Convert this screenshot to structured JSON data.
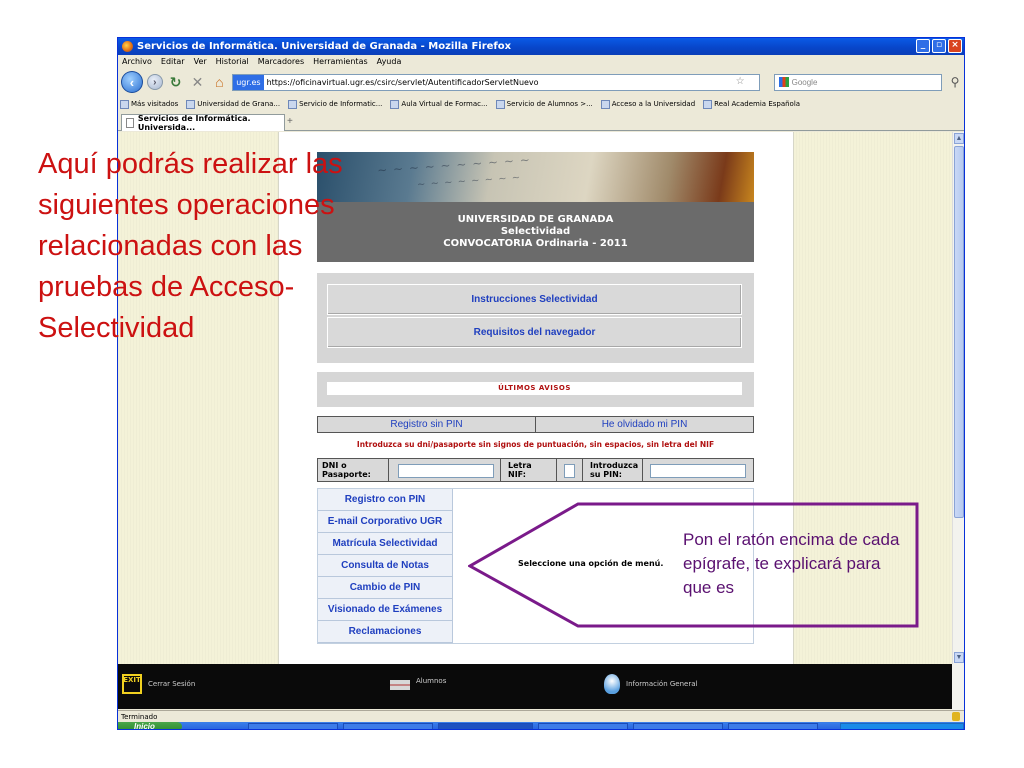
{
  "window": {
    "title": "Servicios de Informática. Universidad de Granada - Mozilla Firefox",
    "menu": [
      "Archivo",
      "Editar",
      "Ver",
      "Historial",
      "Marcadores",
      "Herramientas",
      "Ayuda"
    ],
    "url_site": "ugr.es",
    "url": "https://oficinavirtual.ugr.es/csirc/servlet/AutentificadorServletNuevo",
    "search_placeholder": "Google",
    "bookmarks": [
      "Más visitados",
      "Universidad de Grana...",
      "Servicio de Informatic...",
      "Aula Virtual de Formac...",
      "Servicio de Alumnos >...",
      "Acceso a la Universidad",
      "Real Academia Española"
    ],
    "tab_label": "Servicios de Informática. Universida...",
    "status": "Terminado"
  },
  "page": {
    "header_line1": "UNIVERSIDAD DE GRANADA",
    "header_line2": "Selectividad",
    "header_line3": "CONVOCATORIA Ordinaria - 2011",
    "instr_1": "Instrucciones Selectividad",
    "instr_2": "Requisitos del navegador",
    "avisos": "ÚLTIMOS AVISOS",
    "registro_sin_pin": "Registro sin PIN",
    "olvidado_pin": "He olvidado mi PIN",
    "intro_text": "Introduzca su dni/pasaporte sin signos de puntuación, sin espacios, sin letra del NIF",
    "dni_label_1": "DNI o",
    "dni_label_2": "Pasaporte:",
    "nif_label_1": "Letra",
    "nif_label_2": "NIF:",
    "pin_label_1": "Introduzca",
    "pin_label_2": "su PIN:",
    "menu_items": [
      "Registro con PIN",
      "E-mail Corporativo UGR",
      "Matrícula Selectividad",
      "Consulta de Notas",
      "Cambio de PIN",
      "Visionado de Exámenes",
      "Reclamaciones"
    ],
    "select_msg": "Seleccione una opción de menú."
  },
  "appbar": {
    "exit_icon_text": "EXIT",
    "cerrar": "Cerrar Sesión",
    "alumnos": "Alumnos",
    "info": "Información General"
  },
  "taskbar": {
    "start": "Inicio"
  },
  "annotations": {
    "left": "Aquí podrás realizar las siguientes operaciones relacionadas con las pruebas de Acceso-Selectividad",
    "right": "Pon el ratón encima de cada epígrafe, te explicará para que es"
  },
  "colors": {
    "annotation_left": "#cc1111",
    "annotation_right": "#5a1070",
    "arrow": "#7a1a8a",
    "link_blue": "#1f3fbf"
  }
}
